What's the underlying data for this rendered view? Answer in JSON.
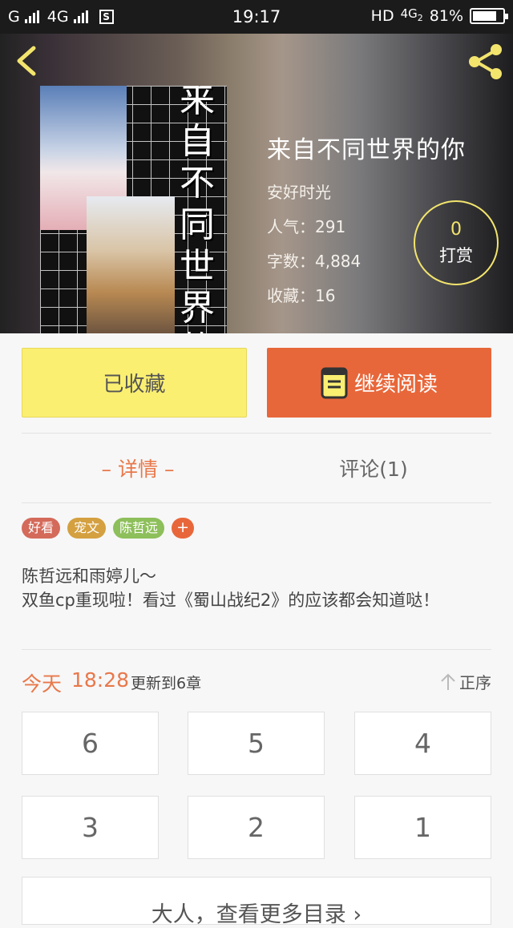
{
  "status_bar": {
    "carrier_left": "G",
    "network": "4G",
    "sim_label": "S",
    "time": "19:17",
    "hd": "HD",
    "network_right": "4G",
    "network_right_sub": "2",
    "battery_percent": "81%",
    "battery_level": 0.81
  },
  "book": {
    "title": "来自不同世界的你",
    "author": "安好时光",
    "popularity": "人气：291",
    "word_count": "字数：4,884",
    "favorites": "收藏：16",
    "cover_title": "来自不同世界的你"
  },
  "tip": {
    "count": "0",
    "label": "打赏"
  },
  "actions": {
    "favorite_label": "已收藏",
    "read_label": "继续阅读"
  },
  "tabs": {
    "detail": "– 详情 –",
    "comments": "评论(1)"
  },
  "tags": [
    {
      "label": "好看",
      "color": "#d46a5a"
    },
    {
      "label": "宠文",
      "color": "#d4a040"
    },
    {
      "label": "陈哲远",
      "color": "#8dbf5a"
    }
  ],
  "tag_add": "+",
  "description": {
    "line1": "陈哲远和雨婷儿～",
    "line2": "双鱼cp重现啦！看过《蜀山战纪2》的应该都会知道哒！"
  },
  "update": {
    "today": "今天",
    "time": "18:28",
    "text": "更新到6章",
    "order_label": "正序"
  },
  "chapters": [
    "6",
    "5",
    "4",
    "3",
    "2",
    "1"
  ],
  "more_label": "大人，查看更多目录 ›",
  "colors": {
    "accent_orange": "#e8673a",
    "favorite_yellow": "#fbef72",
    "tip_ring": "#f3e46d"
  }
}
